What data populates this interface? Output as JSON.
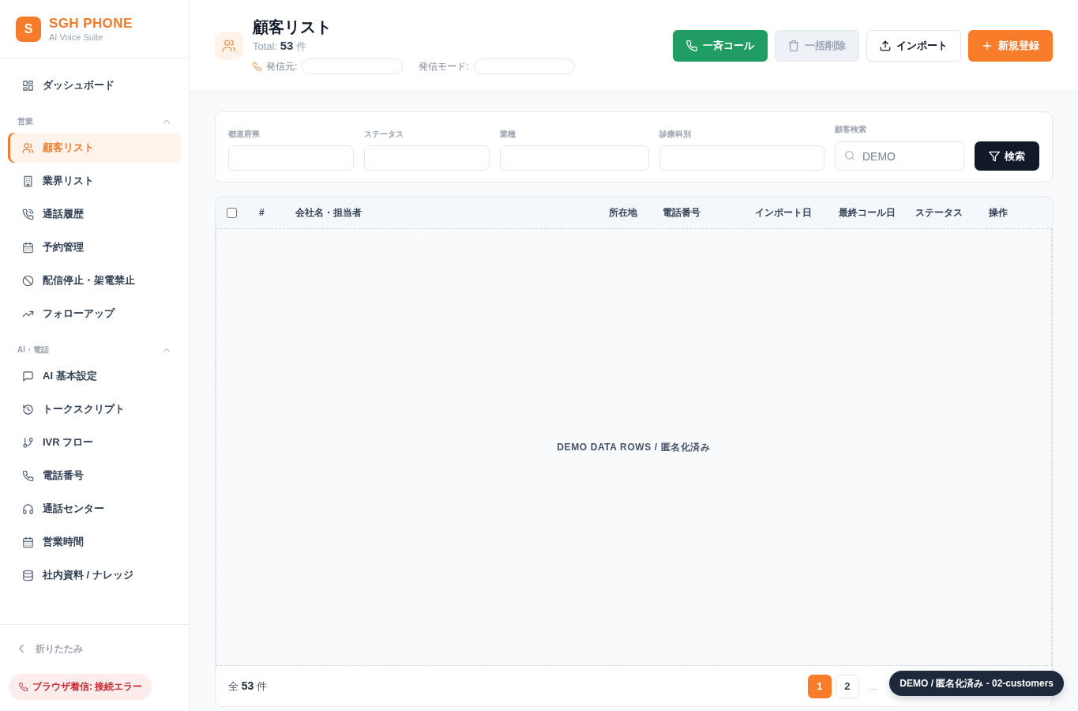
{
  "sidebar": {
    "brand": {
      "logo_letter": "S",
      "name": "SGH PHONE",
      "tagline": "AI Voice Suite"
    },
    "top_items": [
      {
        "label": "ダッシュボード",
        "selected": false
      }
    ],
    "sections": [
      {
        "title": "営業",
        "expanded": true,
        "items": [
          {
            "label": "顧客リスト",
            "selected": true
          },
          {
            "label": "業界リスト",
            "selected": false
          },
          {
            "label": "通話履歴",
            "selected": false
          },
          {
            "label": "予約管理",
            "selected": false
          },
          {
            "label": "配信停止・架電禁止",
            "selected": false
          },
          {
            "label": "フォローアップ",
            "selected": false
          }
        ]
      },
      {
        "title": "AI・電話",
        "expanded": true,
        "items": [
          {
            "label": "AI 基本設定",
            "selected": false
          },
          {
            "label": "トークスクリプト",
            "selected": false
          },
          {
            "label": "IVR フロー",
            "selected": false
          },
          {
            "label": "電話番号",
            "selected": false
          },
          {
            "label": "通話センター",
            "selected": false
          },
          {
            "label": "営業時間",
            "selected": false
          },
          {
            "label": "社内資料 / ナレッジ",
            "selected": false
          }
        ]
      }
    ],
    "collapse_label": "折りたたみ",
    "call_status": {
      "kind": "error",
      "text": "ブラウザ着信: 接続エラー"
    }
  },
  "header": {
    "title": "顧客リスト",
    "total": "Total: **53** 件",
    "fields": [
      {
        "label": "発信元:"
      },
      {
        "label": "発信モード:"
      }
    ],
    "actions": [
      {
        "label": "一斉コール",
        "kind": "call",
        "disabled": false
      },
      {
        "label": "一括削除",
        "kind": "delete",
        "disabled": true
      },
      {
        "label": "インポート",
        "kind": "import",
        "disabled": false
      },
      {
        "label": "新規登録",
        "kind": "create",
        "disabled": false
      }
    ]
  },
  "filters": {
    "fields": [
      {
        "label": "都道府県",
        "kind": "input"
      },
      {
        "label": "ステータス",
        "kind": "input"
      },
      {
        "label": "業種",
        "kind": "input"
      },
      {
        "label": "診療科別",
        "kind": "input"
      },
      {
        "label": "顧客検索",
        "kind": "search",
        "placeholder": "DEMO"
      }
    ],
    "search_button": "検索"
  },
  "table": {
    "select_all": {
      "checked": false
    },
    "columns": [
      "#",
      "会社名・担当者",
      "所在地",
      "電話番号",
      "インポート日",
      "最終コール日",
      "ステータス",
      "操作"
    ],
    "empty_message": "DEMO DATA ROWS / 匿名化済み",
    "footer": {
      "total": "全 **53** 件",
      "pages": [
        {
          "label": "1",
          "selected": true
        },
        {
          "label": "2",
          "selected": false
        }
      ],
      "ellipsis": "..."
    }
  },
  "demo_badge": "DEMO / 匿名化済み - 02-customers"
}
